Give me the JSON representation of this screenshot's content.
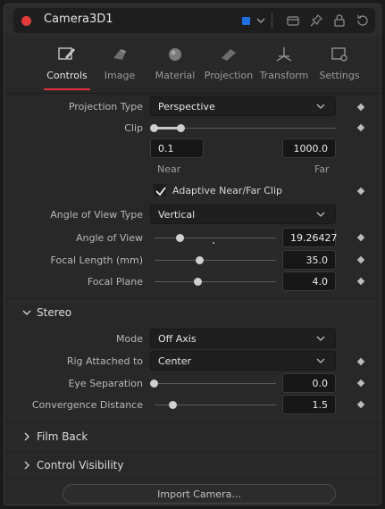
{
  "header": {
    "tool_name": "Camera3D1",
    "swatch_color": "#1d6fe0"
  },
  "tabs": [
    {
      "label": "Controls",
      "icon": "controls-icon",
      "active": true
    },
    {
      "label": "Image",
      "icon": "image-icon"
    },
    {
      "label": "Material",
      "icon": "material-icon"
    },
    {
      "label": "Projection",
      "icon": "projection-icon"
    },
    {
      "label": "Transform",
      "icon": "transform-icon"
    },
    {
      "label": "Settings",
      "icon": "settings-icon"
    }
  ],
  "controls": {
    "projection_type_label": "Projection Type",
    "projection_type_value": "Perspective",
    "clip_label": "Clip",
    "clip_near_value": "0.1",
    "clip_far_value": "1000.0",
    "clip_near_label": "Near",
    "clip_far_label": "Far",
    "adaptive_label": "Adaptive Near/Far Clip",
    "aov_type_label": "Angle of View Type",
    "aov_type_value": "Vertical",
    "aov_label": "Angle of View",
    "aov_value": "19.26427",
    "focal_length_label": "Focal Length (mm)",
    "focal_length_value": "35.0",
    "focal_plane_label": "Focal Plane",
    "focal_plane_value": "4.0"
  },
  "stereo": {
    "title": "Stereo",
    "mode_label": "Mode",
    "mode_value": "Off Axis",
    "rig_label": "Rig Attached to",
    "rig_value": "Center",
    "eye_sep_label": "Eye Separation",
    "eye_sep_value": "0.0",
    "conv_label": "Convergence Distance",
    "conv_value": "1.5"
  },
  "sections": {
    "film_back": "Film Back",
    "control_visibility": "Control Visibility"
  },
  "import_button": "Import Camera..."
}
